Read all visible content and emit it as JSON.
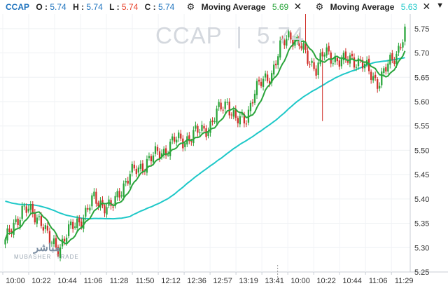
{
  "legend": {
    "symbol": "CCAP",
    "o_label": "O :",
    "o_value": "5.74",
    "h_label": "H :",
    "h_value": "5.74",
    "l_label": "L :",
    "l_value": "5.74",
    "c_label": "C :",
    "c_value": "5.74",
    "ma1_title": "Moving Average",
    "ma1_value": "5.69",
    "ma2_title": "Moving Average",
    "ma2_value": "5.63"
  },
  "watermark": {
    "symbol": "CCAP",
    "separator": "|",
    "price": "5.74"
  },
  "logo": {
    "arabic": "مباشر",
    "latin": "MUBASHER",
    "sub": "TRADE"
  },
  "colors": {
    "up": "#2aa53b",
    "down": "#d0302a",
    "ma_fast": "#2aa53b",
    "ma_slow": "#1ec8c8"
  },
  "chart_data": {
    "type": "candlestick",
    "ylim": [
      5.25,
      5.78
    ],
    "y_ticks": [
      "5.75",
      "5.70",
      "5.65",
      "5.60",
      "5.55",
      "5.50",
      "5.45",
      "5.40",
      "5.35",
      "5.30",
      "5.25"
    ],
    "x_ticks": [
      "10:00",
      "10:22",
      "10:44",
      "11:06",
      "11:28",
      "11:50",
      "12:12",
      "12:36",
      "12:57",
      "13:19",
      "13:41",
      "10:00",
      "10:22",
      "10:44",
      "11:06",
      "11:29"
    ],
    "session_break_after_tick": 10,
    "close_series": [
      5.31,
      5.35,
      5.38,
      5.37,
      5.36,
      5.31,
      5.3,
      5.33,
      5.35,
      5.37,
      5.4,
      5.39,
      5.38,
      5.42,
      5.45,
      5.46,
      5.48,
      5.49,
      5.5,
      5.52,
      5.52,
      5.53,
      5.54,
      5.55,
      5.58,
      5.6,
      5.56,
      5.56,
      5.62,
      5.64,
      5.66,
      5.71,
      5.74,
      5.72,
      5.69,
      5.67,
      5.7,
      5.69,
      5.68,
      5.69,
      5.68,
      5.66,
      5.64,
      5.67,
      5.7,
      5.74
    ],
    "wick_extremes": [
      {
        "x_tick": "10:22",
        "low": 5.28
      },
      {
        "x_tick": "10:00",
        "high": 5.78
      },
      {
        "x_tick": "10:00",
        "low": 5.56
      }
    ],
    "series": [
      {
        "name": "Moving Average",
        "last": 5.69
      },
      {
        "name": "Moving Average",
        "last": 5.63
      }
    ]
  }
}
